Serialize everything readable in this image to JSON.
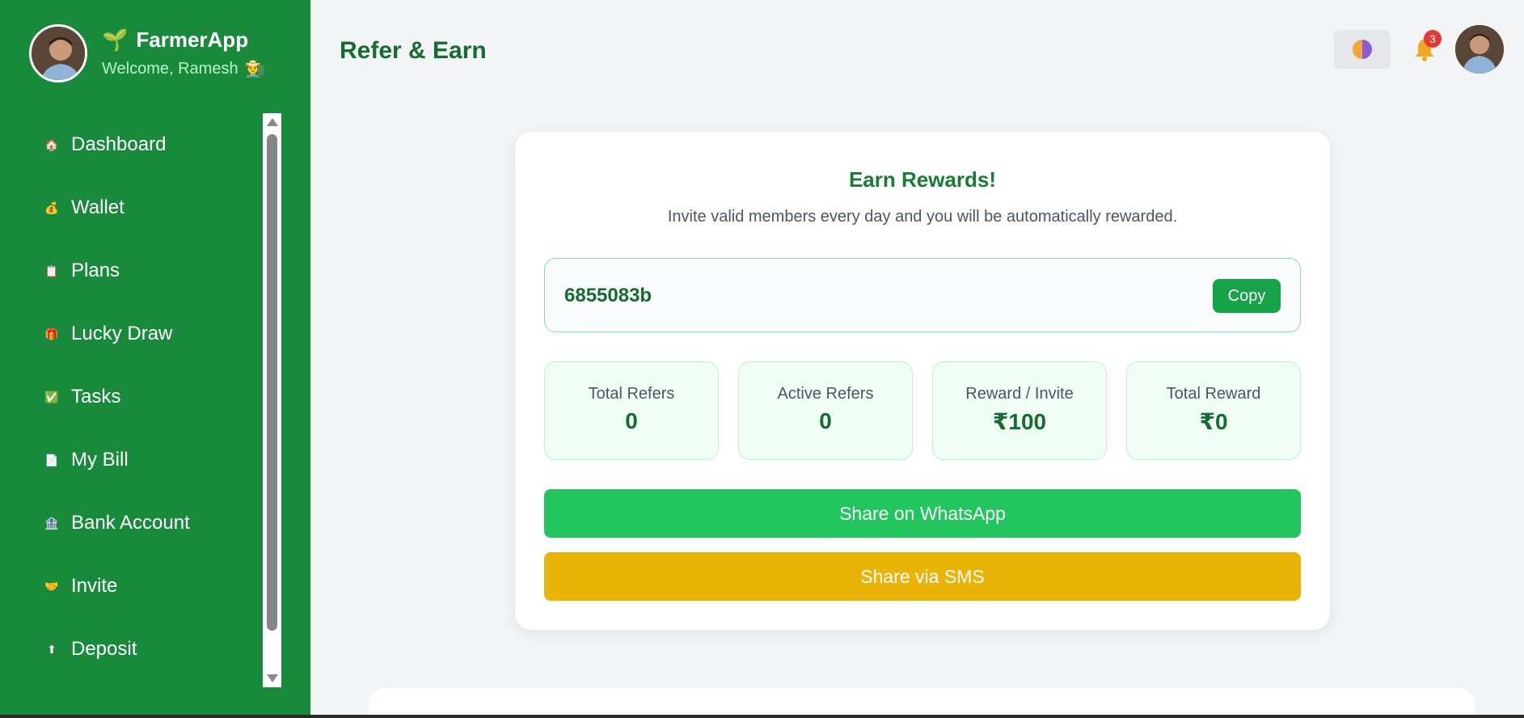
{
  "sidebar": {
    "app_name": "FarmerApp",
    "brand_emoji": "🌱",
    "welcome": "Welcome, Ramesh",
    "welcome_emoji": "👨‍🌾",
    "items": [
      {
        "label": "Dashboard",
        "icon": "🏠",
        "icon_name": "home-icon"
      },
      {
        "label": "Wallet",
        "icon": "💰",
        "icon_name": "money-bag-icon"
      },
      {
        "label": "Plans",
        "icon": "📋",
        "icon_name": "clipboard-icon"
      },
      {
        "label": "Lucky Draw",
        "icon": "🎁",
        "icon_name": "gift-icon"
      },
      {
        "label": "Tasks",
        "icon": "✅",
        "icon_name": "checkbox-icon"
      },
      {
        "label": "My Bill",
        "icon": "📄",
        "icon_name": "document-icon"
      },
      {
        "label": "Bank Account",
        "icon": "🏦",
        "icon_name": "bank-icon"
      },
      {
        "label": "Invite",
        "icon": "🤝",
        "icon_name": "handshake-icon"
      },
      {
        "label": "Deposit",
        "icon": "⬆",
        "icon_name": "up-arrow-icon"
      }
    ]
  },
  "header": {
    "title": "Refer & Earn",
    "notification_count": "3"
  },
  "card": {
    "title": "Earn Rewards!",
    "subtitle": "Invite valid members every day and you will be automatically rewarded.",
    "referral_code": "6855083b",
    "copy_label": "Copy",
    "stats": [
      {
        "label": "Total Refers",
        "value": "0"
      },
      {
        "label": "Active Refers",
        "value": "0"
      },
      {
        "label": "Reward / Invite",
        "value": "₹100"
      },
      {
        "label": "Total Reward",
        "value": "₹0"
      }
    ],
    "share_whatsapp": "Share on WhatsApp",
    "share_sms": "Share via SMS"
  },
  "colors": {
    "sidebar_bg": "#198a3c",
    "accent": "#16a34a",
    "whatsapp": "#22c55e",
    "sms": "#eab308"
  }
}
